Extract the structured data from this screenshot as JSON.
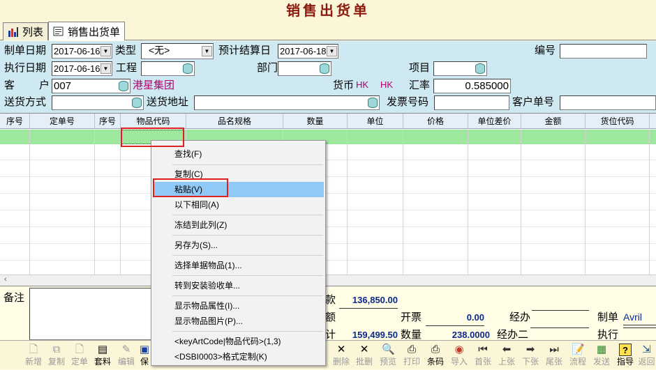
{
  "window": {
    "title": "销售出货单"
  },
  "tabs": [
    {
      "label": "列表",
      "icon": "chart-icon"
    },
    {
      "label": "销售出货单",
      "icon": "form-icon"
    }
  ],
  "form": {
    "make_date_label": "制单日期",
    "make_date": "2017-06-16",
    "type_label": "类型",
    "type_value": "<无>",
    "settle_date_label": "预计结算日",
    "settle_date": "2017-06-18",
    "number_label": "编号",
    "number_value": "",
    "exec_date_label": "执行日期",
    "exec_date": "2017-06-16",
    "project_label": "工程",
    "project_value": "",
    "dept_label": "部门",
    "dept_value": "",
    "item_label": "项目",
    "item_value": "",
    "customer_label_1": "客",
    "customer_label_2": "户",
    "customer_code": "007",
    "customer_name": "港星集团",
    "currency_label": "货币",
    "currency_1": "HK",
    "currency_2": "HK",
    "rate_label": "汇率",
    "rate_value": "0.585000",
    "ship_method_label": "送货方式",
    "ship_method_value": "",
    "ship_addr_label": "送货地址",
    "ship_addr_value": "",
    "invoice_label": "发票号码",
    "invoice_value": "",
    "cust_order_label": "客户单号",
    "cust_order_value": ""
  },
  "grid": {
    "columns": [
      "序号",
      "定单号",
      "序号",
      "物品代码",
      "品名规格",
      "数量",
      "单位",
      "价格",
      "单位差价",
      "金额",
      "货位代码"
    ]
  },
  "bottom": {
    "remark_label": "备注",
    "amount_label": "款",
    "amount_value": "136,850.00",
    "invoice_label": "开票",
    "invoice_value": "0.00",
    "handler_label": "经办",
    "handler_value": "",
    "maker_label": "制单",
    "maker_value": "Avril",
    "total_label": "额",
    "subtotal_label": "计",
    "subtotal_value": "159,499.50",
    "qty_label": "数量",
    "qty_value": "238.0000",
    "handler2_label": "经办二",
    "handler2_value": "",
    "exec_label": "执行",
    "exec_value": ""
  },
  "toolbar": [
    {
      "label": "新增",
      "icon": "new-doc-icon",
      "enabled": false
    },
    {
      "label": "复制",
      "icon": "copy-icon",
      "enabled": false
    },
    {
      "label": "定单",
      "icon": "order-icon",
      "enabled": false
    },
    {
      "label": "套料",
      "icon": "kit-icon",
      "enabled": true
    },
    {
      "label": "编辑",
      "icon": "edit-icon",
      "enabled": false
    },
    {
      "label": "保",
      "icon": "save-icon",
      "enabled": true
    },
    {
      "label": "删除",
      "icon": "delete-icon",
      "enabled": false
    },
    {
      "label": "批删",
      "icon": "batch-delete-icon",
      "enabled": false
    },
    {
      "label": "预览",
      "icon": "preview-icon",
      "enabled": false
    },
    {
      "label": "打印",
      "icon": "print-icon",
      "enabled": false
    },
    {
      "label": "条码",
      "icon": "barcode-icon",
      "enabled": true
    },
    {
      "label": "导入",
      "icon": "import-icon",
      "enabled": false
    },
    {
      "label": "首张",
      "icon": "first-icon",
      "enabled": false
    },
    {
      "label": "上张",
      "icon": "prev-icon",
      "enabled": false
    },
    {
      "label": "下张",
      "icon": "next-icon",
      "enabled": false
    },
    {
      "label": "尾张",
      "icon": "last-icon",
      "enabled": false
    },
    {
      "label": "流程",
      "icon": "flow-icon",
      "enabled": false
    },
    {
      "label": "发送",
      "icon": "send-icon",
      "enabled": false
    },
    {
      "label": "指导",
      "icon": "help-icon",
      "enabled": true
    },
    {
      "label": "返回",
      "icon": "exit-icon",
      "enabled": false
    }
  ],
  "context_menu": [
    {
      "label": "查找(F)"
    },
    {
      "label": "复制(C)"
    },
    {
      "label": "粘贴(V)",
      "highlighted": true
    },
    {
      "label": "以下相同(A)"
    },
    {
      "label": "冻结到此列(Z)"
    },
    {
      "label": "另存为(S)..."
    },
    {
      "label": "选择单据物品(1)..."
    },
    {
      "label": "转到安装验收单..."
    },
    {
      "label": "显示物品属性(I)..."
    },
    {
      "label": "显示物品图片(P)..."
    },
    {
      "label": "<keyArtCode|物品代码>(1,3)"
    },
    {
      "label": "<DSBI0003>格式定制(K)"
    }
  ],
  "colors": {
    "title": "#8b1a0e",
    "form_bg": "#cfe9f3",
    "selected_row": "#9ee89e",
    "menu_highlight": "#91c9f7",
    "annotation": "#e02020",
    "customer_name": "#b0006e"
  }
}
